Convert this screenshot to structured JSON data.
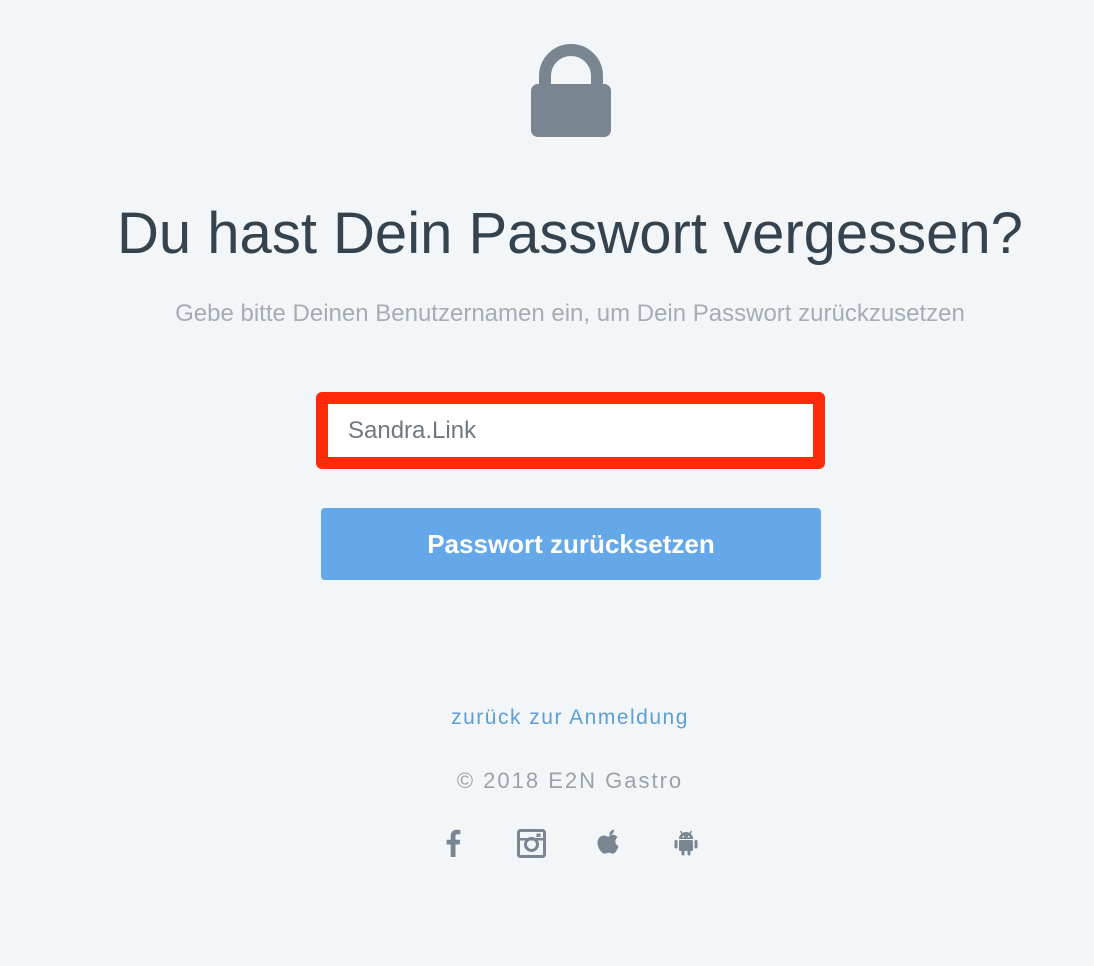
{
  "page": {
    "title": "Du hast Dein Passwort vergessen?",
    "subtitle": "Gebe bitte Deinen Benutzernamen ein, um Dein Passwort zurückzusetzen"
  },
  "form": {
    "username_value": "Sandra.Link",
    "submit_label": "Passwort zurücksetzen"
  },
  "footer": {
    "back_link": "zurück zur Anmeldung",
    "copyright": "© 2018 E2N Gastro",
    "social_icons": [
      "facebook-icon",
      "instagram-icon",
      "apple-icon",
      "android-icon"
    ]
  },
  "icons": {
    "header": "lock-icon"
  },
  "colors": {
    "background": "#f3f6f9",
    "title": "#35434f",
    "subtitle": "#a5acb4",
    "highlight_border": "#ff2a0a",
    "button": "#64a8ea",
    "link": "#5c9fd8",
    "icon": "#7a8592"
  }
}
